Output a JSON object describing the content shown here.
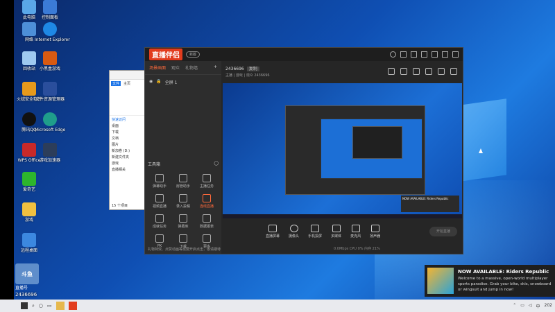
{
  "desktop": {
    "icons": [
      {
        "label": "此电脑",
        "color": "#5aa7e8"
      },
      {
        "label": "控制面板",
        "color": "#3b7bd6"
      },
      {
        "label": "网络",
        "color": "#4d8fd8"
      },
      {
        "label": "Internet Explorer",
        "color": "#1e88e5"
      },
      {
        "label": "回收站",
        "color": "#9ec9f0"
      },
      {
        "label": "小黑盒游戏",
        "color": "#d85a12"
      },
      {
        "label": "火绒安全软件",
        "color": "#e79a1c"
      },
      {
        "label": "文件资源管理器",
        "color": "#2a4e9c"
      },
      {
        "label": "腾讯QQ",
        "color": "#111111"
      },
      {
        "label": "Microsoft Edge",
        "color": "#1f9e8b"
      },
      {
        "label": "WPS Office",
        "color": "#c82929"
      },
      {
        "label": "游戏加速器",
        "color": "#2c3d5a"
      },
      {
        "label": "爱奇艺",
        "color": "#2db52d"
      },
      {
        "label": "游戏",
        "color": "#f0c040"
      },
      {
        "label": "远程桌面",
        "color": "#3c88e0"
      }
    ]
  },
  "explorer": {
    "tabs": [
      "文件",
      "主页"
    ],
    "items": [
      "快速访问",
      "桌面",
      "下载",
      "文档",
      "图片",
      "新加卷 (D:)",
      "新建文件夹",
      "游戏",
      "直播相关"
    ],
    "status": "15 个项目"
  },
  "app": {
    "logo": "直播伴侣",
    "version_tag": "新版",
    "sidebar_tabs": [
      "场景画面",
      "观众",
      "礼物墙"
    ],
    "source_item": "全屏 1",
    "toolbox_title": "工具箱",
    "tools": [
      "弹幕助手",
      "房管助手",
      "主播任务",
      "视频直播",
      "录入投稿",
      "连线直播",
      "成就任务",
      "弹幕库",
      "数据报表",
      "PK",
      "下载",
      "更多"
    ],
    "notice": "礼物特效、点赞动画等需要开启点击，敬请期待",
    "room_id": "2436696",
    "room_tag": "复制",
    "room_subinfo": "主播 | 游戏 | 观众 2436696",
    "controls": [
      "直播屏幕",
      "摄像头",
      "手机投屏",
      "多媒体",
      "麦克风",
      "扬声器"
    ],
    "go_live": "开始直播",
    "bottom_info": "0.0Mbps  CPU 0%  内存 21%"
  },
  "preview": {
    "toast_title": "NOW AVAILABLE: Riders Republic"
  },
  "toast": {
    "title": "NOW AVAILABLE: Riders Republic",
    "body": "Welcome to a massive, open-world multiplayer sports paradise. Grab your bike, skis, snowboard or wingsuit and jump in now!"
  },
  "watermark": {
    "logo": "斗鱼",
    "sub": "直播号",
    "id": "2436696"
  },
  "taskbar": {
    "clock": "202"
  }
}
